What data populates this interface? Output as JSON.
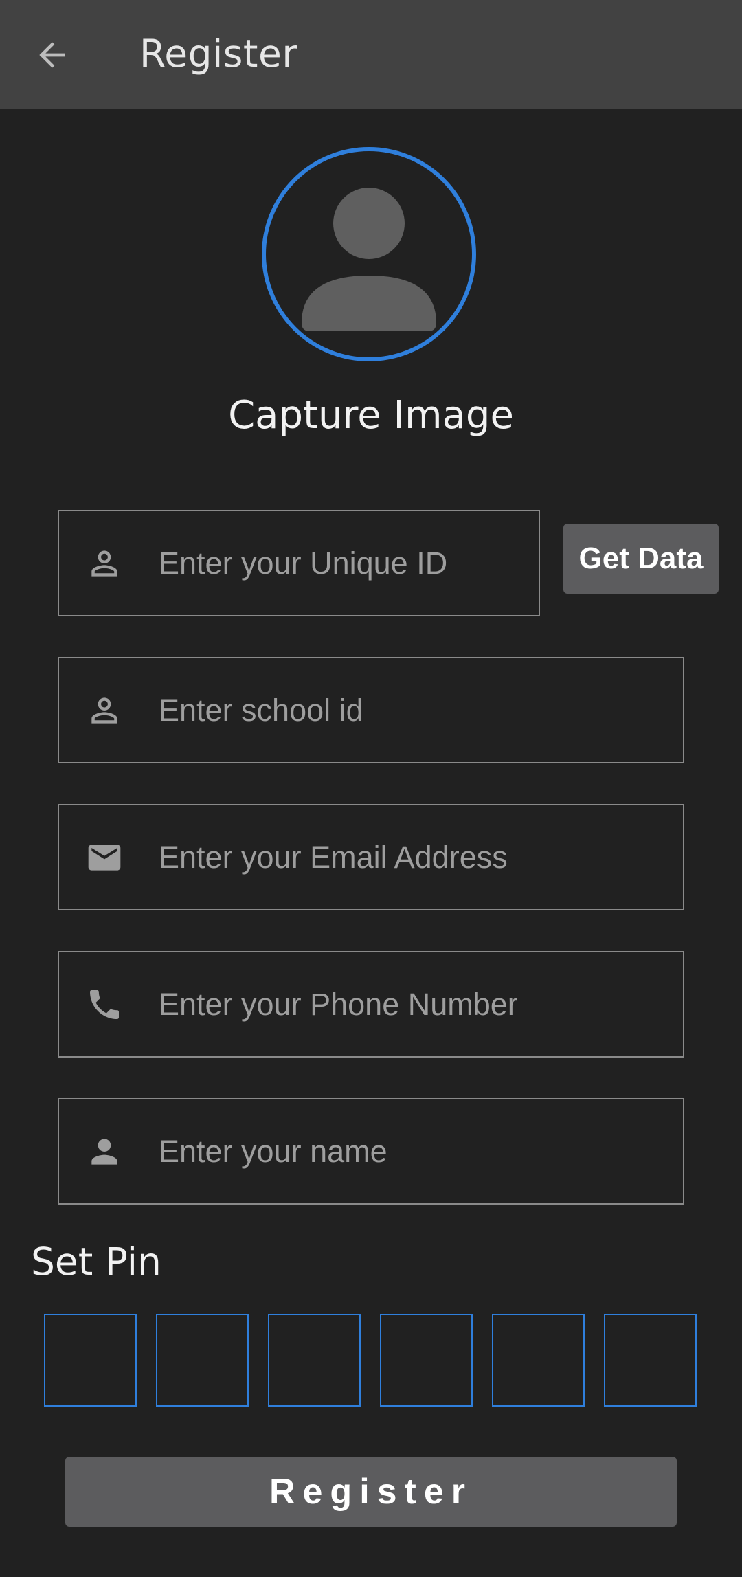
{
  "appbar": {
    "back_icon": "arrow-left-icon",
    "title": "Register"
  },
  "avatar": {
    "icon": "person-placeholder-icon",
    "caption": "Capture Image",
    "ring_color": "#2f7fdc"
  },
  "form": {
    "unique_id": {
      "icon": "person-outline-icon",
      "placeholder": "Enter your Unique ID",
      "value": ""
    },
    "get_data_label": "Get Data",
    "school_id": {
      "icon": "person-outline-icon",
      "placeholder": "Enter school id",
      "value": ""
    },
    "email": {
      "icon": "mail-icon",
      "placeholder": "Enter your Email Address",
      "value": ""
    },
    "phone": {
      "icon": "phone-icon",
      "placeholder": "Enter your Phone Number",
      "value": ""
    },
    "name": {
      "icon": "person-filled-icon",
      "placeholder": "Enter your name",
      "value": ""
    }
  },
  "pin": {
    "label": "Set Pin",
    "digits": [
      "",
      "",
      "",
      "",
      "",
      ""
    ],
    "box_color": "#2f7fdc"
  },
  "register_label": "Register"
}
